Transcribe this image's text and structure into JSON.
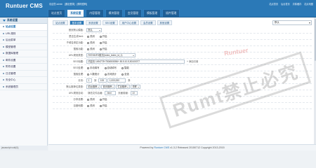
{
  "header": {
    "logo": "Runtuer CMS",
    "user_text": "欢迎您 admin",
    "user_links": [
      "[退出登录]",
      "[修改密码]"
    ],
    "quick_links": [
      "站点首页",
      "后台首页",
      "清除缓存",
      "站点地图"
    ],
    "nav": [
      "站点首页",
      "系统设置",
      "内容管理",
      "模块管理",
      "会员管理",
      "模板管理",
      "插件管理"
    ]
  },
  "sidebar": {
    "heading": "系统设置",
    "items": [
      "站点设置",
      "URL规则",
      "后台菜单",
      "模型管理",
      "数据库管理",
      "邮件设置",
      "附件设置",
      "日志管理",
      "安全中心",
      "系统管理员"
    ]
  },
  "main": {
    "subtabs": [
      "站点设置",
      "基本设置",
      "系统设置",
      "SEO设置",
      "用户中心设置",
      "会员设置",
      "其他设置"
    ],
    "site_select": "默认",
    "rows": [
      {
        "label": "首页默认模板:",
        "type": "select",
        "value": "默认"
      },
      {
        "label": "是否生成html:",
        "type": "radio",
        "options": [
          "关闭",
          "开启"
        ],
        "selected": 0
      },
      {
        "label": "子域名绑定功能:",
        "type": "radio",
        "options": [
          "关闭",
          "开启"
        ],
        "selected": 0
      },
      {
        "label": "搜索功能:",
        "type": "radio",
        "options": [
          "关闭",
          "开启"
        ],
        "selected": 0
      },
      {
        "label": "URL规则类型:",
        "type": "select",
        "value": "PATHINFO模式(index_index_id_1)"
      },
      {
        "label": "SEO标题:",
        "type": "input",
        "value": "内容页 1494778+7504500056+.50.5.10.5,50100077",
        "extra": "+ 添加引用"
      },
      {
        "label": "SEO处理:",
        "type": "radio",
        "options": [
          "手动填写",
          "自动填写",
          "智能"
        ],
        "selected": 1
      },
      {
        "label": "搜索处理:",
        "type": "radio",
        "options": [
          "人数统计",
          "访问统计",
          "全选"
        ],
        "selected": 0
      },
      {
        "label": "分页:",
        "type": "pager",
        "parts": [
          "1",
          "到",
          "100",
          "1,000,000",
          "条"
        ]
      },
      {
        "label": "默认推荐位类型:",
        "type": "multiselect",
        "values": [
          "前台推荐",
          "首页推荐",
          "栏目推荐",
          "关联"
        ]
      },
      {
        "label": "URL规则自动:",
        "type": "textfields",
        "parts": [
          "静态文件后缀:",
          ".html",
          "页面前缀:",
          "10"
        ]
      },
      {
        "label": "分享设置:",
        "type": "radio",
        "options": [
          "关闭",
          "开启"
        ],
        "selected": 0
      },
      {
        "label": "百度地图:",
        "type": "radio",
        "options": [
          "关闭",
          "开启"
        ],
        "selected": 0
      }
    ]
  },
  "watermark": "Rumt禁止必究",
  "watermark_small": "Runtuer",
  "footer": {
    "prefix": "Powered by",
    "brand": "Runtuer CMS",
    "rest": "v1.3.2 Released 20150712 Copyright 2013-2015"
  },
  "status": "javascript:void(0);"
}
